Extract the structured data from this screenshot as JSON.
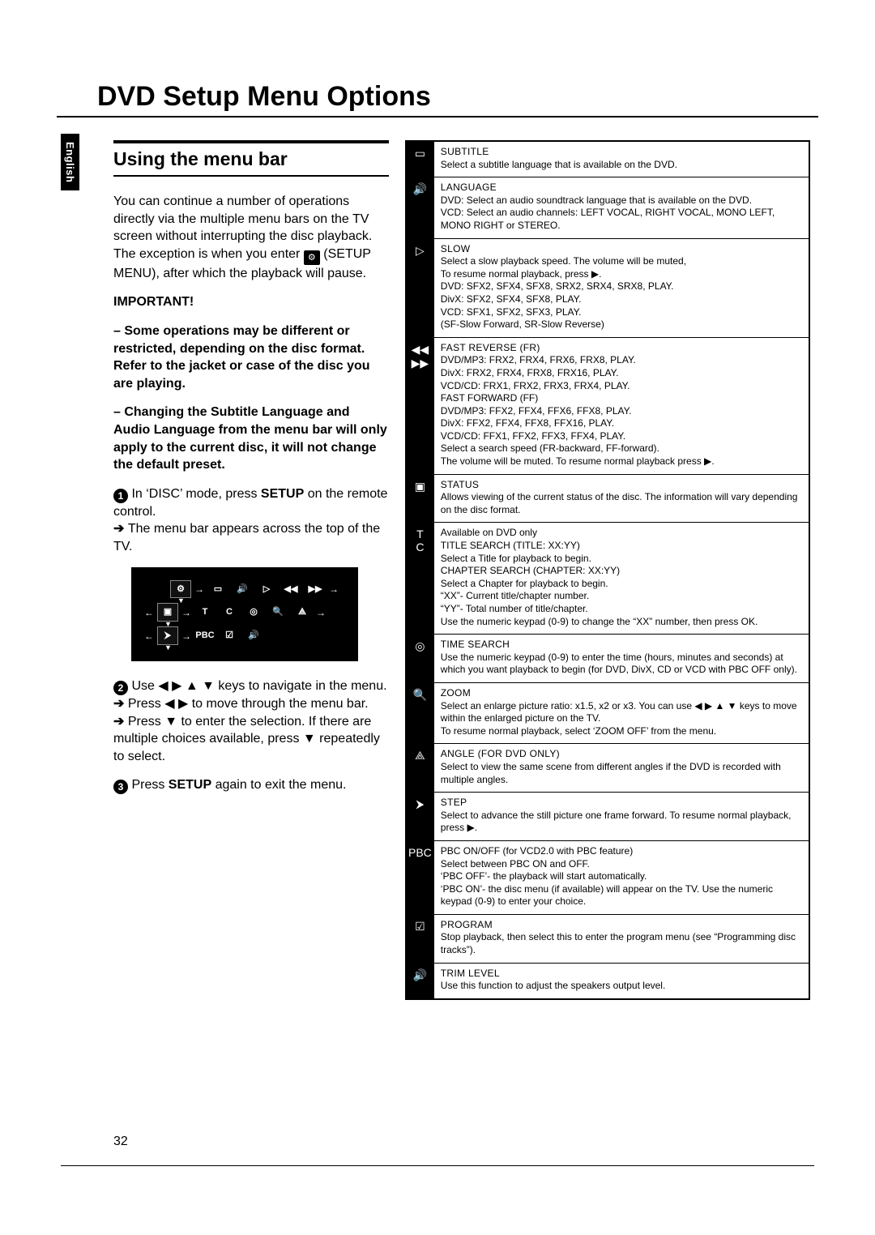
{
  "lang_tab": "English",
  "page_number": "32",
  "title": "DVD Setup Menu Options",
  "section": {
    "heading": "Using the menu bar",
    "intro": "You can continue a number of operations directly via the multiple menu bars on the TV screen without interrupting the disc playback. The exception is when you enter",
    "intro_after_icon": "(SETUP MENU), after which the playback will pause.",
    "important_label": "IMPORTANT!",
    "important_1": "– Some operations may be different or restricted, depending on the disc format. Refer to the jacket or case of the disc you are playing.",
    "important_2": "– Changing the Subtitle Language and Audio Language from the menu bar will only apply to the current disc, it will not change the default preset.",
    "step1_a": "In ‘DISC’ mode, press ",
    "step1_b_bold": "SETUP",
    "step1_c": " on the remote control.",
    "step1_result": "The menu bar appears across the top of the TV.",
    "step2_a": "Use ◀ ▶ ▲ ▼ keys to navigate in the menu.",
    "step2_r1": "Press ◀ ▶ to move through the menu bar.",
    "step2_r2": "Press ▼ to enter the selection. If there are multiple choices available, press ▼ repeatedly to select.",
    "step3_a": "Press ",
    "step3_b_bold": "SETUP",
    "step3_c": " again to exit the menu."
  },
  "menubar": {
    "row1": [
      "⚙",
      "▭",
      "🔊",
      "▷",
      "◀◀",
      "▶▶"
    ],
    "row2": [
      "▣",
      "T",
      "C",
      "◎",
      "🔍",
      "⟁"
    ],
    "row3": [
      "⮞",
      "PBC",
      "☑",
      "🔊"
    ]
  },
  "table": [
    {
      "icon": "▭",
      "title": "SUBTITLE",
      "body": "Select a subtitle language that is available on the DVD."
    },
    {
      "icon": "🔊",
      "title": "LANGUAGE",
      "body": "DVD: Select an audio soundtrack language that is available on the DVD.\nVCD: Select an audio channels: LEFT VOCAL, RIGHT VOCAL, MONO LEFT, MONO RIGHT or STEREO."
    },
    {
      "icon": "▷",
      "title": "SLOW",
      "body": "Select a slow playback speed. The volume will be muted,\nTo resume normal playback, press ▶.\nDVD: SFX2, SFX4, SFX8, SRX2, SRX4, SRX8, PLAY.\nDivX: SFX2, SFX4, SFX8, PLAY.\nVCD: SFX1, SFX2, SFX3, PLAY.\n(SF-Slow Forward, SR-Slow Reverse)"
    },
    {
      "icon": "◀◀\n▶▶",
      "title": "FAST REVERSE (FR)",
      "body": "DVD/MP3: FRX2, FRX4, FRX6, FRX8, PLAY.\nDivX: FRX2, FRX4, FRX8, FRX16, PLAY.\nVCD/CD: FRX1, FRX2, FRX3, FRX4, PLAY.\nFAST FORWARD (FF)\nDVD/MP3: FFX2, FFX4, FFX6, FFX8, PLAY.\nDivX: FFX2, FFX4, FFX8, FFX16, PLAY.\nVCD/CD: FFX1, FFX2, FFX3, FFX4, PLAY.\nSelect a search speed (FR-backward, FF-forward).\nThe volume will be muted. To resume normal playback press ▶."
    },
    {
      "icon": "▣",
      "title": "STATUS",
      "body": "Allows viewing of the current status of the disc. The information will vary depending on the disc format."
    },
    {
      "icon": "T\nC",
      "title": "",
      "body": "Available on DVD only\nTITLE SEARCH (TITLE: XX:YY)\nSelect a Title for playback to begin.\nCHAPTER SEARCH (CHAPTER: XX:YY)\nSelect a Chapter for playback to begin.\n“XX”- Current title/chapter number.\n“YY”- Total number of title/chapter.\nUse the numeric keypad (0-9) to change the “XX” number, then press OK."
    },
    {
      "icon": "◎",
      "title": "TIME SEARCH",
      "body": "Use the numeric keypad (0-9) to enter the time (hours, minutes and seconds) at which you want playback to begin (for DVD, DivX, CD or VCD with PBC OFF only)."
    },
    {
      "icon": "🔍",
      "title": "ZOOM",
      "body": "Select an enlarge picture ratio: x1.5, x2 or x3. You can use ◀ ▶ ▲ ▼ keys to move within the enlarged picture on the TV.\nTo resume normal playback, select ‘ZOOM OFF’ from the menu."
    },
    {
      "icon": "⟁",
      "title": "ANGLE (for DVD only)",
      "body": "Select to view the same scene from different angles if the DVD is recorded with multiple angles."
    },
    {
      "icon": "⮞",
      "title": "STEP",
      "body": "Select to advance the still picture one frame forward. To resume normal playback, press ▶."
    },
    {
      "icon": "PBC",
      "title": "",
      "body": "PBC ON/OFF (for VCD2.0 with PBC feature)\nSelect between PBC ON and OFF.\n‘PBC OFF’- the playback will start automatically.\n‘PBC ON’- the disc menu (if available) will appear on the TV. Use the numeric keypad (0-9) to enter your choice."
    },
    {
      "icon": "☑",
      "title": "PROGRAM",
      "body": "Stop playback, then select this to enter the program menu (see “Programming disc tracks”)."
    },
    {
      "icon": "🔊",
      "title": "TRIM LEVEL",
      "body": "Use this function to adjust the speakers output level."
    }
  ]
}
